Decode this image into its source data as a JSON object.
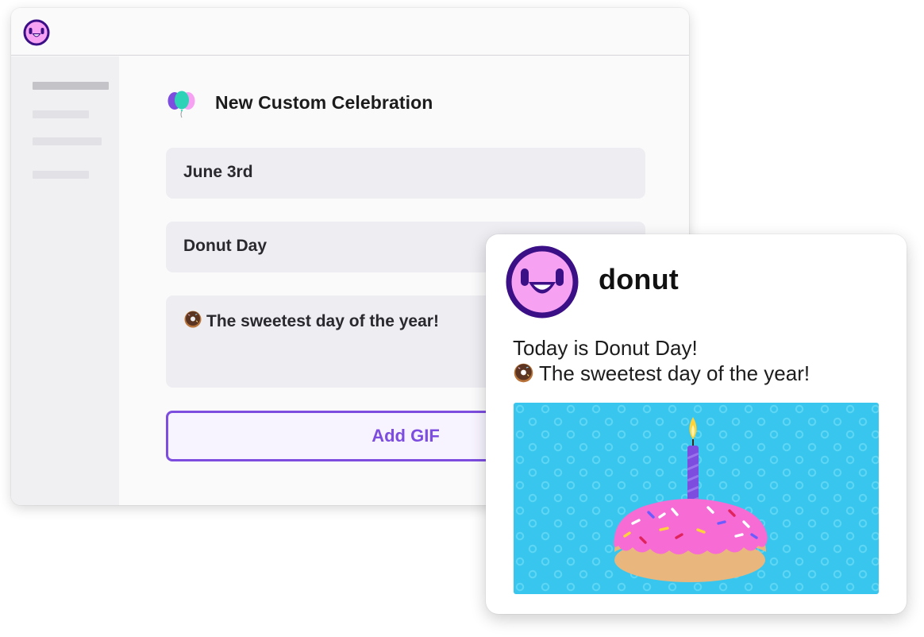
{
  "form": {
    "title": "New Custom Celebration",
    "date_value": "June 3rd",
    "name_value": "Donut Day",
    "message_value": "The sweetest day of the year!",
    "add_gif_label": "Add GIF"
  },
  "preview": {
    "bot_name": "donut",
    "message_line1": "Today is Donut Day!",
    "message_line2": "The sweetest day of the year!"
  },
  "icons": {
    "app_logo": "donut-smiley-icon",
    "balloons": "balloons-icon",
    "message_emoji": "donut-emoji-icon",
    "gif": "birthday-donut-candle-image"
  },
  "colors": {
    "brand_purple": "#7c4dde",
    "logo_pink": "#f7a1f3",
    "logo_dark": "#3b0f86",
    "gif_background": "#39c6ee",
    "frosting": "#f66bd4"
  }
}
